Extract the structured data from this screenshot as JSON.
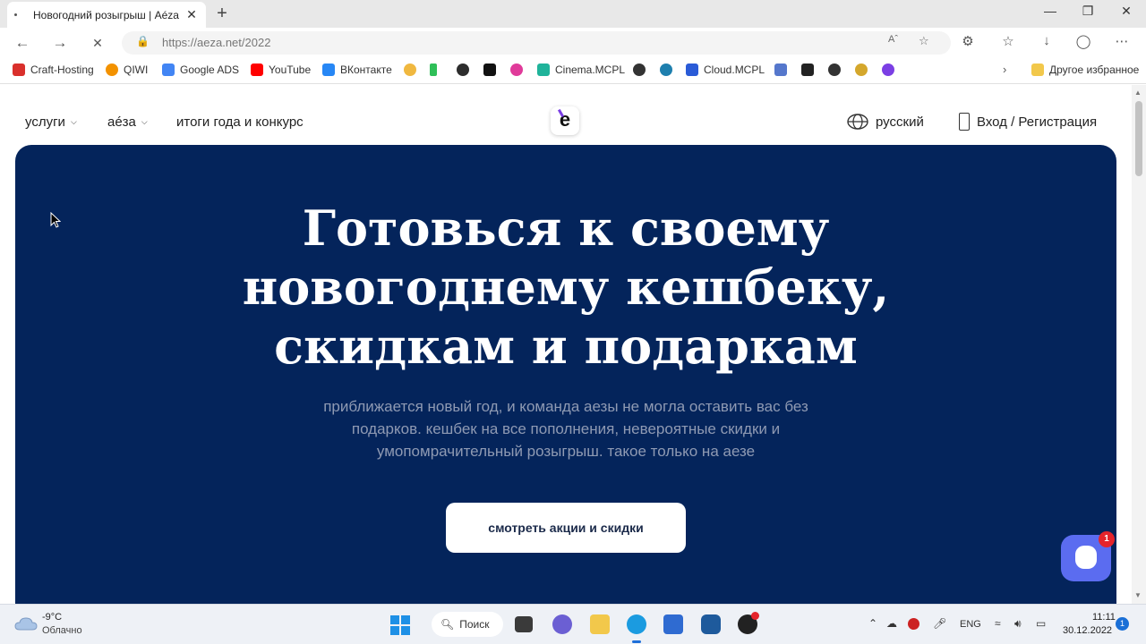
{
  "browser": {
    "tab_title": "Новогодний розыгрыш | Aéza",
    "tab_close": "✕",
    "new_tab": "+",
    "url": "https://aeza.net/2022",
    "window_controls": [
      "—",
      "❐",
      "✕"
    ],
    "nav": {
      "back": "←",
      "forward": "→",
      "stop": "✕"
    }
  },
  "bookmarks": {
    "items": [
      {
        "label": "Craft-Hosting",
        "color": "#d9302c"
      },
      {
        "label": "QIWI",
        "color": "#f39200"
      },
      {
        "label": "Google ADS",
        "color": "#4285f4"
      },
      {
        "label": "YouTube",
        "color": "#ff0000"
      },
      {
        "label": "ВКонтакте",
        "color": "#2787f5"
      },
      {
        "label": "Cinema.MCPL",
        "color": "#1fb39a"
      },
      {
        "label": "Cloud.MCPL",
        "color": "#2a5bd7"
      }
    ],
    "more_label": "Другое избранное"
  },
  "site": {
    "nav": {
      "services": "услуги",
      "aeza": "аéза",
      "results": "итоги года и конкурс",
      "language": "русский",
      "login": "Вход / Регистрация"
    },
    "logo_letter": "e",
    "hero": {
      "title_line1": "Готовься к своему",
      "title_line2": "новогоднему кешбеку,",
      "title_line3": "скидкам и подаркам",
      "subtitle": "приближается новый год, и команда аезы не могла оставить вас без подарков. кешбек на все пополнения, невероятные скидки и умопомрачительный розыгрыш. такое только на аезе",
      "cta": "смотреть акции и скидки"
    },
    "chat_badge": "1",
    "colors": {
      "hero_bg": "#04245b",
      "chat": "#5b6cf0",
      "badge": "#e5242b"
    }
  },
  "taskbar": {
    "weather_temp": "-9°C",
    "weather_desc": "Облачно",
    "search_label": "Поиск",
    "lang": "ENG",
    "time": "11:11",
    "date": "30.12.2022",
    "notif_count": "1"
  }
}
